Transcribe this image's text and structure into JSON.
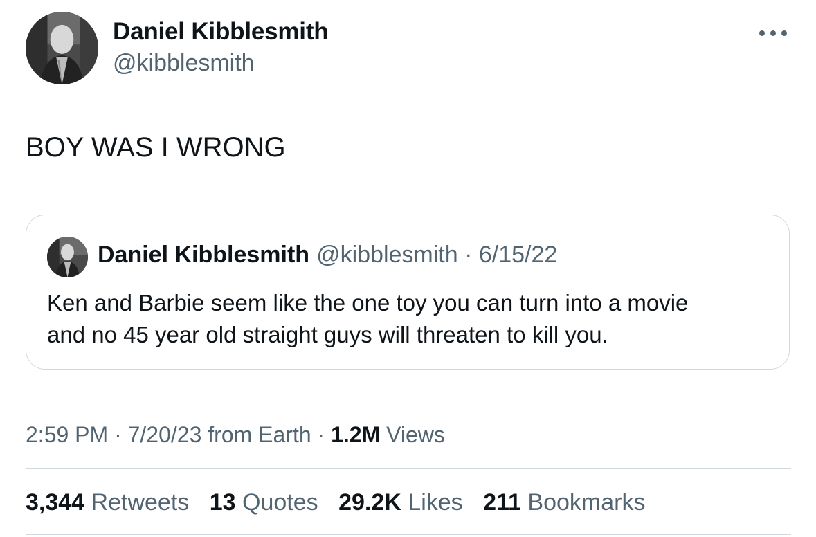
{
  "author": {
    "name": "Daniel Kibblesmith",
    "handle": "@kibblesmith"
  },
  "icons": {
    "more": "more-horizontal-icon",
    "avatar": "profile-photo"
  },
  "tweet": {
    "text": "BOY WAS I WRONG"
  },
  "quoted": {
    "name": "Daniel Kibblesmith",
    "meta": "@kibblesmith · 6/15/22",
    "line1": "Ken and Barbie seem like the one toy you can turn into a movie",
    "line2": "and no 45 year old straight guys will threaten to kill you."
  },
  "meta": {
    "time_prefix": "2:59 PM · 7/20/23 from Earth · ",
    "views_count": "1.2M",
    "views_label": " Views"
  },
  "stats": [
    {
      "num": "3,344",
      "label": "Retweets"
    },
    {
      "num": "13",
      "label": "Quotes"
    },
    {
      "num": "29.2K",
      "label": "Likes"
    },
    {
      "num": "211",
      "label": "Bookmarks"
    }
  ],
  "colors": {
    "text": "#0f1419",
    "secondary": "#536471",
    "border": "#cfd9de"
  }
}
